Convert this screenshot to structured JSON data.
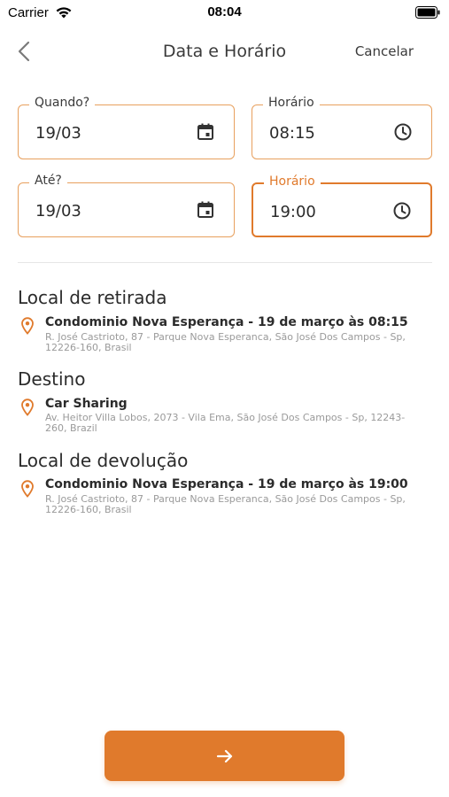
{
  "status_bar": {
    "carrier": "Carrier",
    "time": "08:04"
  },
  "nav": {
    "title": "Data e Horário",
    "cancel_label": "Cancelar"
  },
  "fields": [
    {
      "label": "Quando?",
      "value": "19/03",
      "icon": "calendar-icon"
    },
    {
      "label": "Horário",
      "value": "08:15",
      "icon": "clock-icon"
    },
    {
      "label": "Até?",
      "value": "19/03",
      "icon": "calendar-icon"
    },
    {
      "label": "Horário",
      "value": "19:00",
      "icon": "clock-icon",
      "active": true
    }
  ],
  "sections": [
    {
      "title": "Local de retirada",
      "name": "Condominio Nova Esperança - 19 de março às 08:15",
      "address": "R. José Castrioto, 87 - Parque Nova Esperanca, São José Dos Campos - Sp, 12226-160, Brasil"
    },
    {
      "title": "Destino",
      "name": "Car Sharing",
      "address": "Av. Heitor Villa Lobos, 2073 - Vila Ema, São José Dos Campos - Sp, 12243-260, Brazil"
    },
    {
      "title": "Local de devolução",
      "name": "Condominio Nova Esperança - 19 de março às 19:00",
      "address": "R. José Castrioto, 87 - Parque Nova Esperanca, São José Dos Campos - Sp, 12226-160, Brasil"
    }
  ],
  "colors": {
    "accent": "#e07a2c",
    "field_border": "#e8a05e",
    "muted_text": "#9a9a9a"
  },
  "icons": {
    "back": "chevron-left-icon",
    "pin": "map-pin-icon",
    "next": "arrow-right-icon"
  }
}
